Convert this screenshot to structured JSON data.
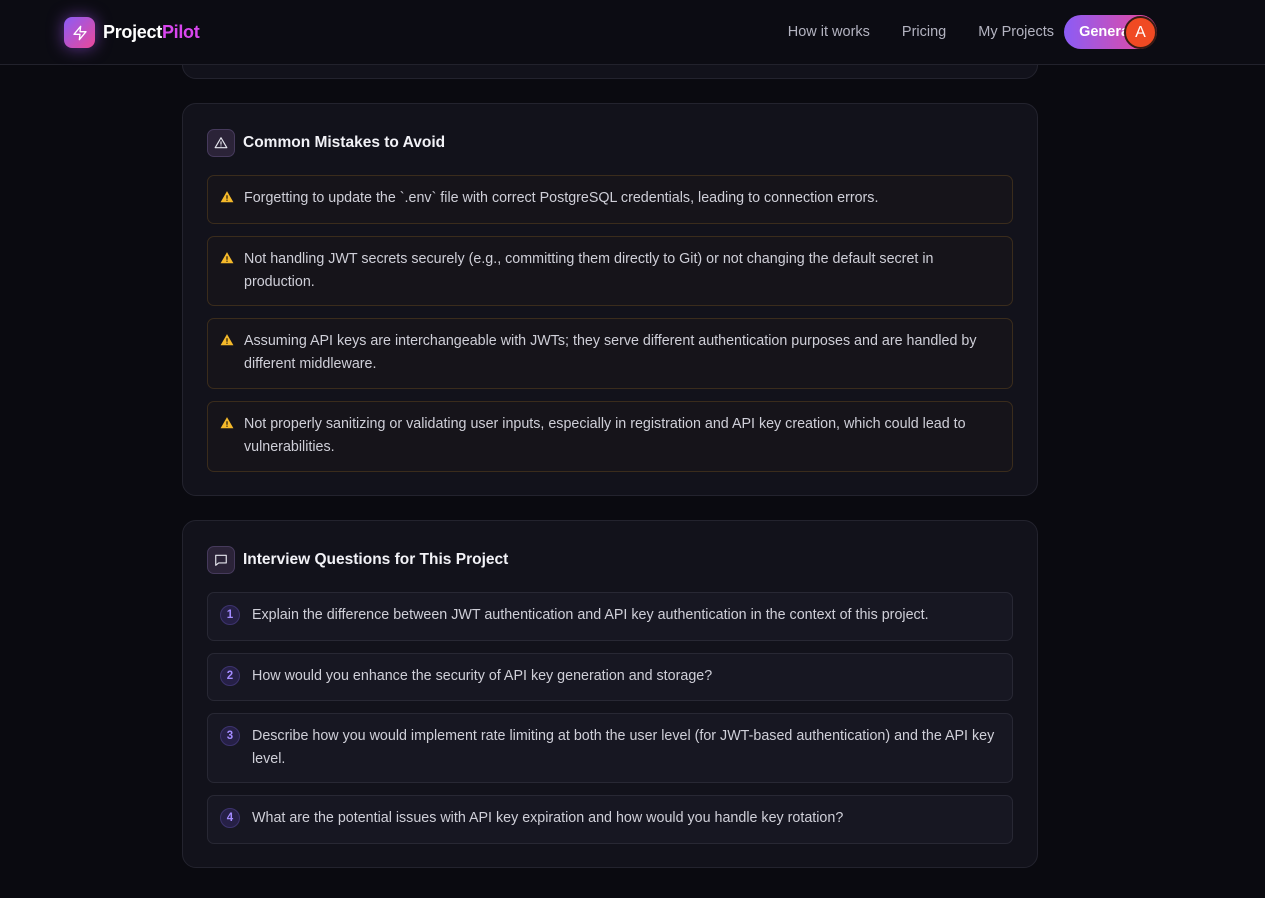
{
  "brand": {
    "name_part1": "Project",
    "name_part2": "Pilot",
    "accent_purple": "#8b5cf6",
    "accent_pink": "#ec4899"
  },
  "nav": {
    "links": [
      "How it works",
      "Pricing",
      "My Projects"
    ],
    "generate_label": "Generate",
    "avatar_initial": "A"
  },
  "mistakes": {
    "title": "Common Mistakes to Avoid",
    "icon": "alert-triangle-icon",
    "items": [
      "Forgetting to update the `.env` file with correct PostgreSQL credentials, leading to connection errors.",
      "Not handling JWT secrets securely (e.g., committing them directly to Git) or not changing the default secret in production.",
      "Assuming API keys are interchangeable with JWTs; they serve different authentication purposes and are handled by different middleware.",
      "Not properly sanitizing or validating user inputs, especially in registration and API key creation, which could lead to vulnerabilities."
    ]
  },
  "interview": {
    "title": "Interview Questions for This Project",
    "icon": "message-square-icon",
    "items": [
      {
        "num": "1",
        "text": "Explain the difference between JWT authentication and API key authentication in the context of this project."
      },
      {
        "num": "2",
        "text": "How would you enhance the security of API key generation and storage?"
      },
      {
        "num": "3",
        "text": "Describe how you would implement rate limiting at both the user level (for JWT-based authentication) and the API key level."
      },
      {
        "num": "4",
        "text": "What are the potential issues with API key expiration and how would you handle key rotation?"
      }
    ]
  }
}
